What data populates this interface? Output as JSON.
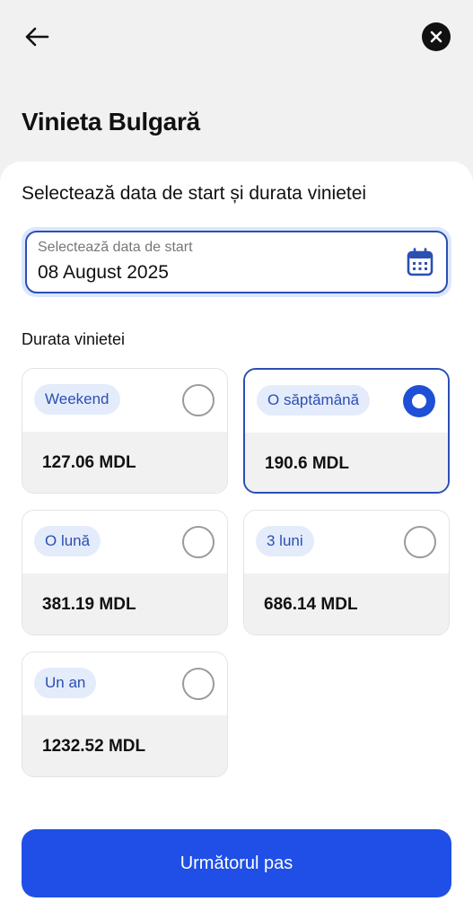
{
  "header": {
    "title": "Vinieta Bulgară",
    "back_icon": "arrow-left-icon",
    "close_icon": "close-icon"
  },
  "form": {
    "heading": "Selectează data de start și durata vinietei",
    "date_field": {
      "label": "Selectează data de start",
      "value": "08 August 2025",
      "icon": "calendar-icon"
    },
    "duration_label": "Durata vinietei",
    "options": [
      {
        "label": "Weekend",
        "price": "127.06 MDL",
        "selected": false
      },
      {
        "label": "O săptămână",
        "price": "190.6 MDL",
        "selected": true
      },
      {
        "label": "O lună",
        "price": "381.19 MDL",
        "selected": false
      },
      {
        "label": "3 luni",
        "price": "686.14 MDL",
        "selected": false
      },
      {
        "label": "Un an",
        "price": "1232.52 MDL",
        "selected": false
      }
    ]
  },
  "footer": {
    "next_label": "Următorul pas"
  },
  "colors": {
    "primary": "#1f4fe6",
    "accent_border": "#2b4fb3",
    "badge_bg": "#e4ecfb",
    "background": "#f1f1f1"
  }
}
